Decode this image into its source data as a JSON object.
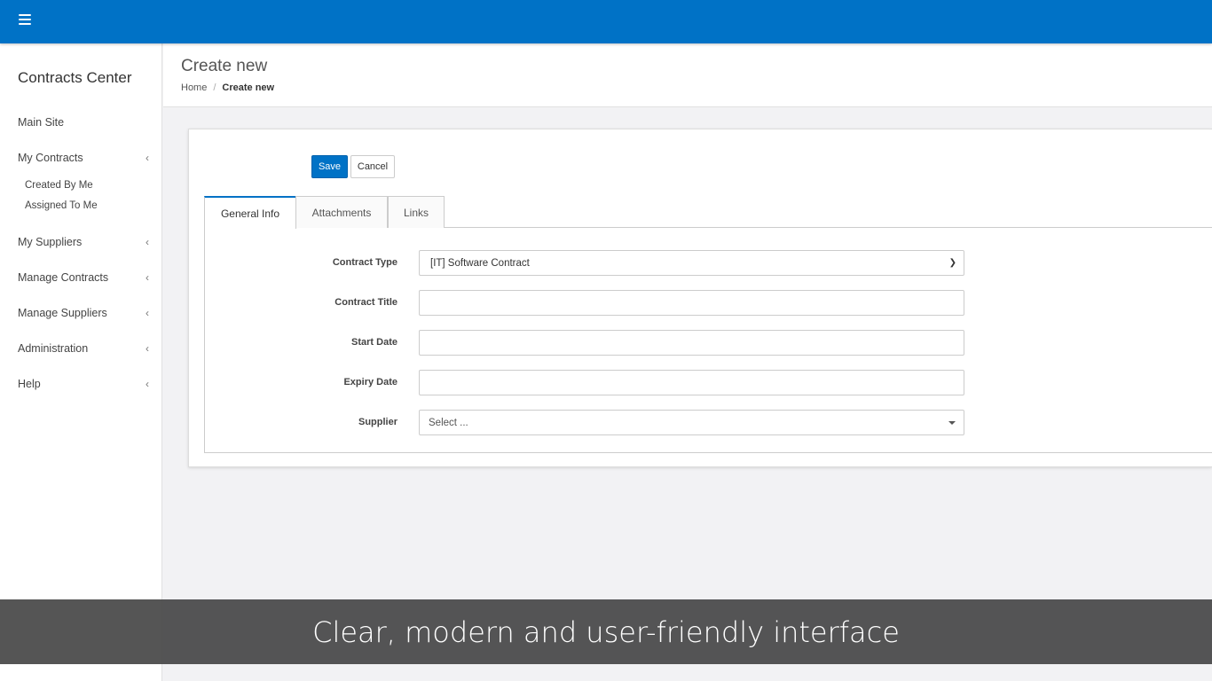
{
  "topbar": {
    "menu_icon": "hamburger-icon",
    "color": "#0072c6"
  },
  "sidebar": {
    "brand": "Contracts Center",
    "items": [
      {
        "label": "Main Site"
      },
      {
        "label": "My Contracts",
        "chevron": "‹"
      },
      {
        "label": "My Suppliers",
        "chevron": "‹"
      },
      {
        "label": "Manage Contracts",
        "chevron": "‹"
      },
      {
        "label": "Manage Suppliers",
        "chevron": "‹"
      },
      {
        "label": "Administration",
        "chevron": "‹"
      },
      {
        "label": "Help",
        "chevron": "‹"
      }
    ],
    "subitems": [
      {
        "label": "Created By Me"
      },
      {
        "label": "Assigned To Me"
      }
    ]
  },
  "header": {
    "title": "Create new",
    "breadcrumb": {
      "home": "Home",
      "separator": "/",
      "current": "Create new"
    }
  },
  "toolbar": {
    "save_label": "Save",
    "cancel_label": "Cancel"
  },
  "tabs": [
    {
      "label": "General Info",
      "active": true
    },
    {
      "label": "Attachments",
      "active": false
    },
    {
      "label": "Links",
      "active": false
    }
  ],
  "form": {
    "contract_type": {
      "label": "Contract Type",
      "value": "[IT] Software Contract"
    },
    "contract_title": {
      "label": "Contract Title",
      "value": ""
    },
    "start_date": {
      "label": "Start Date",
      "value": ""
    },
    "expiry_date": {
      "label": "Expiry Date",
      "value": ""
    },
    "supplier": {
      "label": "Supplier",
      "placeholder": "Select ..."
    }
  },
  "caption": "Clear, modern and user-friendly interface"
}
